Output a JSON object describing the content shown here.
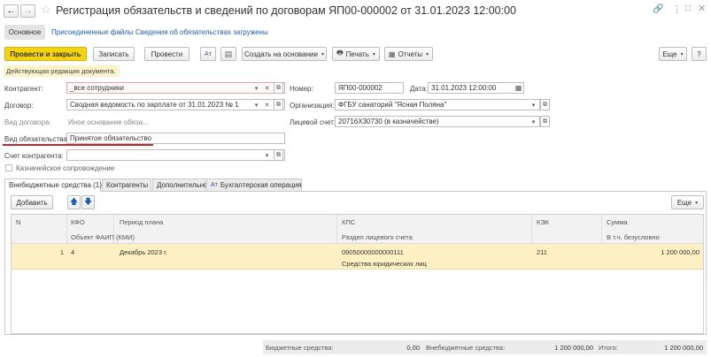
{
  "window": {
    "title": "Регистрация обязательств и сведений по договорам ЯП00-000002 от 31.01.2023 12:00:00"
  },
  "nav_tabs": [
    {
      "label": "Основное"
    },
    {
      "label": "Присоединенные файлы"
    },
    {
      "label": "Сведения об обязательствах загружены"
    }
  ],
  "toolbar": {
    "post_close": "Провести и закрыть",
    "save": "Записать",
    "post": "Провести",
    "create_based": "Создать на основании",
    "print": "Печать",
    "reports": "Отчеты",
    "more": "Еще",
    "help": "?"
  },
  "notice": "Действующая редакция документа.",
  "form": {
    "counterparty_label": "Контрагент:",
    "counterparty_value": "_все сотрудники",
    "contract_label": "Договор:",
    "contract_value": "Сводная ведомость по зарплате от 31.01.2023 № 1",
    "contract_type_label": "Вид договора:",
    "contract_type_value": "Иное основание обяза...",
    "obligation_type_label": "Вид обязательства:",
    "obligation_type_value": "Принятое обязательство",
    "account_label": "Счет контрагента:",
    "account_value": "",
    "treasury_label": "Казначейское сопровождение",
    "number_label": "Номер:",
    "number_value": "ЯП00-000002",
    "date_label": "Дата:",
    "date_value": "31.01.2023 12:00:00",
    "org_label": "Организация:",
    "org_value": "ФГБУ санаторий \"Ясная Поляна\"",
    "account_personal_label": "Лицевой счет:",
    "account_personal_value": "20716Х30730 (в казначействе)"
  },
  "doc_tabs": [
    {
      "label": "Внебюджетные средства (1)"
    },
    {
      "label": "Контрагенты"
    },
    {
      "label": "Дополнительно"
    },
    {
      "label": "Бухгалтерская операция"
    }
  ],
  "table_toolbar": {
    "add": "Добавить",
    "more": "Еще"
  },
  "table": {
    "headers_row1": [
      "N",
      "КФО",
      "Период плана",
      "КПС",
      "КЭК",
      "Сумма"
    ],
    "headers_row2": [
      "Объект ФАИП (КМИ)",
      "Раздел лицевого счета",
      "В т.ч. безусловно"
    ],
    "rows": [
      {
        "n": "1",
        "kfo": "4",
        "period": "Декабрь 2023 г.",
        "kps": "09050000000000111",
        "kek": "211",
        "sum": "1 200 000,00",
        "section": "Средства юридических лиц"
      }
    ]
  },
  "footer": {
    "budget_label": "Бюджетные средства:",
    "budget_value": "0,00",
    "extra_label": "Внебюджетные средства:",
    "extra_value": "1 200 000,00",
    "total_label": "Итого:",
    "total_value": "1 200 000,00"
  },
  "colors": {
    "primary_button": "#f5d30f",
    "selected_row": "#fdf0c2",
    "notice_bg": "#fbf3c9",
    "link": "#1a5fb4",
    "underline": "#c0282d"
  }
}
